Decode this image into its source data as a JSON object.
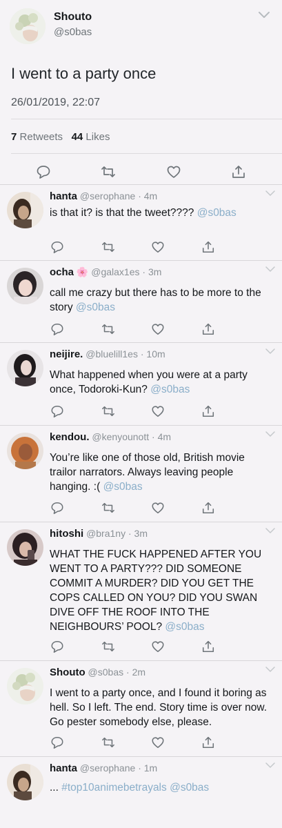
{
  "main_tweet": {
    "display_name": "Shouto",
    "handle": "@s0bas",
    "text": "I went to a party once",
    "timestamp": "26/01/2019, 22:07",
    "retweets_count": "7",
    "retweets_label": "Retweets",
    "likes_count": "44",
    "likes_label": "Likes"
  },
  "replies": [
    {
      "name": "hanta",
      "handle": "@serophane",
      "sep": "·",
      "time": "4m",
      "text": "is that it? is that the tweet????",
      "mention": "@s0bas"
    },
    {
      "name": "ocha",
      "emoji": "🌸",
      "handle": "@galax1es",
      "sep": "·",
      "time": "3m",
      "text": "call me crazy but there has to be more to the story",
      "mention": "@s0bas"
    },
    {
      "name": "neijire.",
      "handle": "@bluelill1es",
      "sep": "·",
      "time": "10m",
      "text": "What happened when you were at a party once, Todoroki-Kun?",
      "mention": "@s0bas"
    },
    {
      "name": "kendou.",
      "handle": "@kenyounott",
      "sep": "·",
      "time": "4m",
      "text": "You’re like one of those old, British movie trailor narrators. Always leaving people hanging. :(",
      "mention": "@s0bas"
    },
    {
      "name": "hitoshi",
      "handle": "@bra1ny",
      "sep": "·",
      "time": "3m",
      "text": "WHAT THE FUCK HAPPENED AFTER YOU WENT TO A PARTY??? DID SOMEONE COMMIT A MURDER? DID YOU GET THE COPS CALLED ON YOU? DID YOU SWAN DIVE OFF THE ROOF INTO THE NEIGHBOURS’ POOL?",
      "mention": "@s0bas"
    },
    {
      "name": "Shouto",
      "handle": "@s0bas",
      "sep": "·",
      "time": "2m",
      "text": "I went to a party once, and I found it boring as hell. So I left. The end. Story time is over now. Go pester somebody else, please.",
      "mention": ""
    },
    {
      "name": "hanta",
      "handle": "@serophane",
      "sep": "·",
      "time": "1m",
      "text": "...",
      "hashtag": "#top10animebetrayals",
      "mention": "@s0bas"
    }
  ],
  "icons": {
    "reply": "speech-bubble-icon",
    "retweet": "retweet-icon",
    "like": "heart-icon",
    "share": "share-icon",
    "menu": "chevron-down-icon"
  },
  "colors": {
    "background": "#f5f3f6",
    "link": "#8aaec9",
    "secondary_text": "#6e7479"
  }
}
